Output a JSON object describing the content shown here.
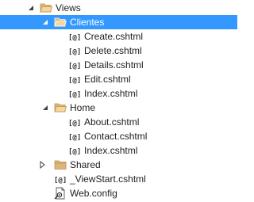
{
  "tree": {
    "views": {
      "label": "Views",
      "icon": "folder-open-icon",
      "expanded": true
    },
    "clientes": {
      "label": "Clientes",
      "icon": "folder-open-icon",
      "expanded": true,
      "selected": true
    },
    "clientes_files": [
      {
        "label": "Create.cshtml",
        "icon": "razor-file-icon"
      },
      {
        "label": "Delete.cshtml",
        "icon": "razor-file-icon"
      },
      {
        "label": "Details.cshtml",
        "icon": "razor-file-icon"
      },
      {
        "label": "Edit.cshtml",
        "icon": "razor-file-icon"
      },
      {
        "label": "Index.cshtml",
        "icon": "razor-file-icon"
      }
    ],
    "home": {
      "label": "Home",
      "icon": "folder-open-icon",
      "expanded": true
    },
    "home_files": [
      {
        "label": "About.cshtml",
        "icon": "razor-file-icon"
      },
      {
        "label": "Contact.cshtml",
        "icon": "razor-file-icon"
      },
      {
        "label": "Index.cshtml",
        "icon": "razor-file-icon"
      }
    ],
    "shared": {
      "label": "Shared",
      "icon": "folder-closed-icon",
      "expanded": false
    },
    "viewstart": {
      "label": "_ViewStart.cshtml",
      "icon": "razor-file-icon"
    },
    "webconfig": {
      "label": "Web.config",
      "icon": "config-file-icon"
    }
  },
  "colors": {
    "selection": "#3399ff",
    "folder": "#dcb67a",
    "text": "#1e1e1e"
  }
}
